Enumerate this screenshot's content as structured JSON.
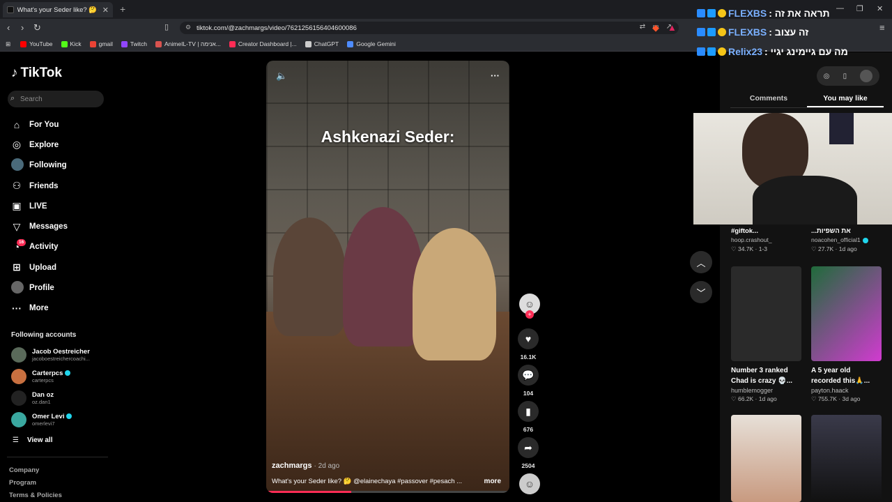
{
  "browser": {
    "tab_title": "What's your Seder like? 🤔 #",
    "url": "tiktok.com/@zachmargs/video/7621256156404600086",
    "bookmarks": [
      {
        "label": "YouTube",
        "color": "#ff0000"
      },
      {
        "label": "Kick",
        "color": "#53fc18"
      },
      {
        "label": "gmail",
        "color": "#ea4335"
      },
      {
        "label": "Twitch",
        "color": "#9146ff"
      },
      {
        "label": "AnimeIL-TV | אנימה...",
        "color": "#d9534f"
      },
      {
        "label": "Creator Dashboard |...",
        "color": "#fe2c55"
      },
      {
        "label": "ChatGPT",
        "color": "#cccccc"
      },
      {
        "label": "Google Gemini",
        "color": "#4e8cff"
      }
    ]
  },
  "tiktok": {
    "logo": "TikTok",
    "search_placeholder": "Search",
    "nav": [
      {
        "label": "For You",
        "icon": "home-icon"
      },
      {
        "label": "Explore",
        "icon": "compass-icon"
      },
      {
        "label": "Following",
        "icon": "avatar-icon"
      },
      {
        "label": "Friends",
        "icon": "friends-icon"
      },
      {
        "label": "LIVE",
        "icon": "live-icon"
      },
      {
        "label": "Messages",
        "icon": "paperplane-icon"
      },
      {
        "label": "Activity",
        "icon": "activity-icon",
        "badge": "16"
      },
      {
        "label": "Upload",
        "icon": "plus-box-icon"
      },
      {
        "label": "Profile",
        "icon": "profile-avatar"
      },
      {
        "label": "More",
        "icon": "more-icon"
      }
    ],
    "following_title": "Following accounts",
    "following_accounts": [
      {
        "name": "Jacob Oestreicher",
        "handle": "jacoboestreichercoachi...",
        "verified": false,
        "color": "#5a6a5a"
      },
      {
        "name": "Carterpcs",
        "handle": "carterpcs",
        "verified": true,
        "color": "#c87040"
      },
      {
        "name": "Dan oz",
        "handle": "oz.dan1",
        "verified": false,
        "color": "#222222"
      },
      {
        "name": "Omer Levi",
        "handle": "omerlevi7",
        "verified": true,
        "color": "#3aa8a0"
      }
    ],
    "view_all": "View all",
    "footer_links": [
      "Company",
      "Program",
      "Terms & Policies"
    ]
  },
  "video": {
    "overlay_title": "Ashkenazi Seder:",
    "author": "zachmargs",
    "age": "· 2d ago",
    "caption": "What's your Seder like? 🤔 @elainechaya #passover #pesach ...",
    "more": "more",
    "progress_fraction": 0.35,
    "likes": "16.1K",
    "comments": "104",
    "saves": "676",
    "shares": "2504"
  },
  "right_panel": {
    "tabs": [
      "Comments",
      "You may like"
    ],
    "active_tab": "You may like",
    "stubs": [
      {
        "title": "#giftok...",
        "user": "hoop.crashout_",
        "stats": "♡ 34.7K · 1-3"
      },
      {
        "title": "...את השפיות",
        "user": "noacohen_official1",
        "stats": "♡ 27.7K · 1d ago"
      }
    ],
    "cards": [
      {
        "title": "Number 3 ranked Chad is crazy 💀...",
        "user": "humblemogger",
        "stats": "♡ 66.2K · 1d ago",
        "color": "#2a2a2a"
      },
      {
        "title": "A 5 year old recorded this🙏...",
        "user": "payton.haack",
        "stats": "♡ 755.7K · 3d ago",
        "color": "#1f6b3a"
      },
      {
        "title": "",
        "user": "",
        "stats": "",
        "color": "#c89a80"
      },
      {
        "title": "",
        "user": "",
        "stats": "",
        "color": "#222a3a"
      }
    ]
  },
  "stream_chat": [
    {
      "name": "FLEXBS",
      "text": ": תראה את זה"
    },
    {
      "name": "FLEXBS",
      "text": ": זה עצוב"
    },
    {
      "name": "Relix23",
      "text": ": מה עם גיימינג יגיי"
    }
  ]
}
